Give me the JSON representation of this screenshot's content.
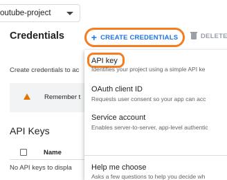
{
  "project": {
    "name": "outube-project"
  },
  "header": {
    "title": "Credentials",
    "create_label": "CREATE CREDENTIALS",
    "delete_label": "DELETE"
  },
  "intro": {
    "text": "Create credentials to ac"
  },
  "notice": {
    "text": "Remember t"
  },
  "api_keys": {
    "title": "API Keys",
    "column_name": "Name",
    "empty": "No API keys to displa"
  },
  "menu": {
    "items": [
      {
        "label": "API key",
        "desc": "Identifies your project using a simple API ke"
      },
      {
        "label": "OAuth client ID",
        "desc": "Requests user consent so your app can acc"
      },
      {
        "label": "Service account",
        "desc": "Enables server-to-server, app-level authentic"
      },
      {
        "label": "Help me choose",
        "desc": "Asks a few questions to help you decide wh"
      }
    ]
  },
  "colors": {
    "accent": "#1a73e8",
    "highlight": "#f57c1f",
    "warning": "#e37400"
  }
}
